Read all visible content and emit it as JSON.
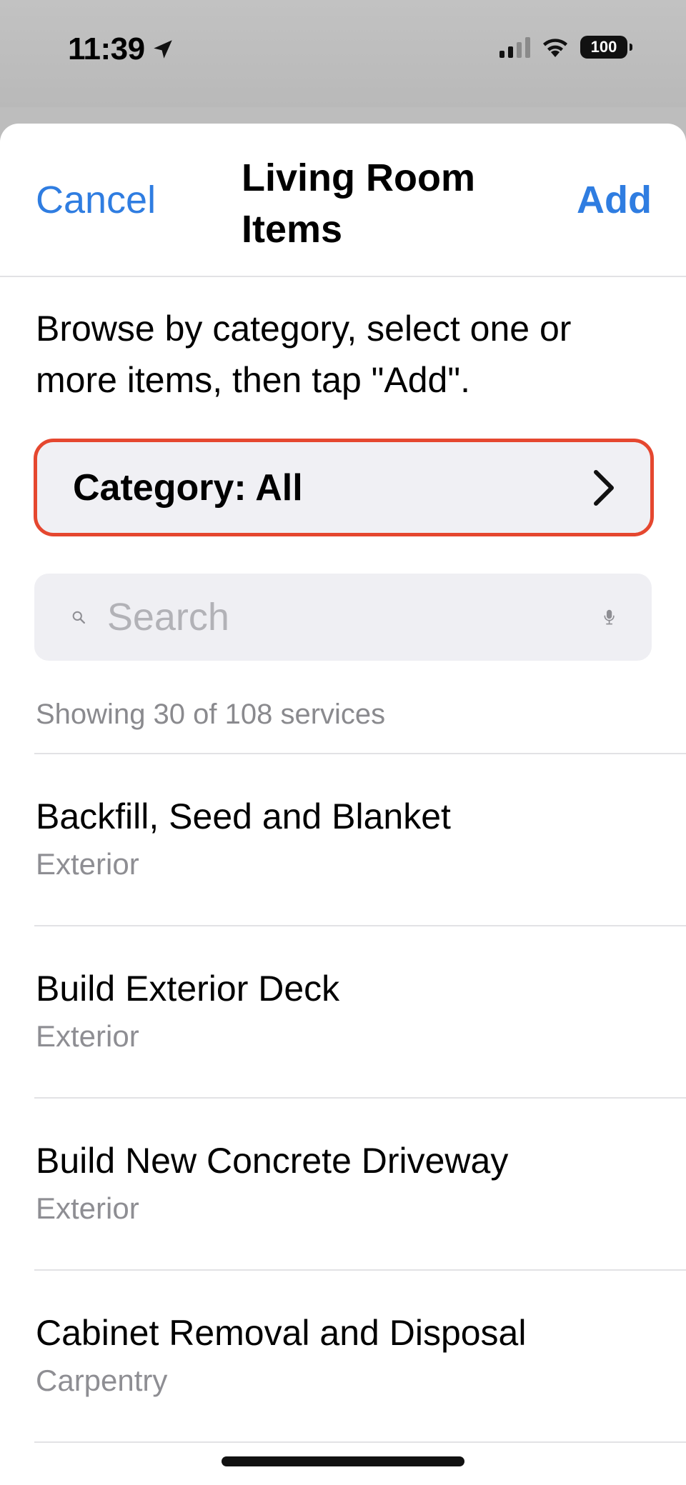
{
  "status_bar": {
    "time": "11:39",
    "battery": "100"
  },
  "nav": {
    "cancel_label": "Cancel",
    "title": "Living Room Items",
    "add_label": "Add"
  },
  "instructions": "Browse by category, select one or more items, then tap \"Add\".",
  "category_button": {
    "label": "Category: All"
  },
  "search": {
    "placeholder": "Search",
    "value": ""
  },
  "results_count": "Showing 30 of 108 services",
  "services": [
    {
      "title": "Backfill, Seed and Blanket",
      "category": "Exterior"
    },
    {
      "title": "Build Exterior Deck",
      "category": "Exterior"
    },
    {
      "title": "Build New Concrete Driveway",
      "category": "Exterior"
    },
    {
      "title": "Cabinet Removal and Disposal",
      "category": "Carpentry"
    }
  ],
  "colors": {
    "accent": "#2f7de1",
    "highlight_border": "#e5472f",
    "secondary_text": "#8e8e93"
  }
}
